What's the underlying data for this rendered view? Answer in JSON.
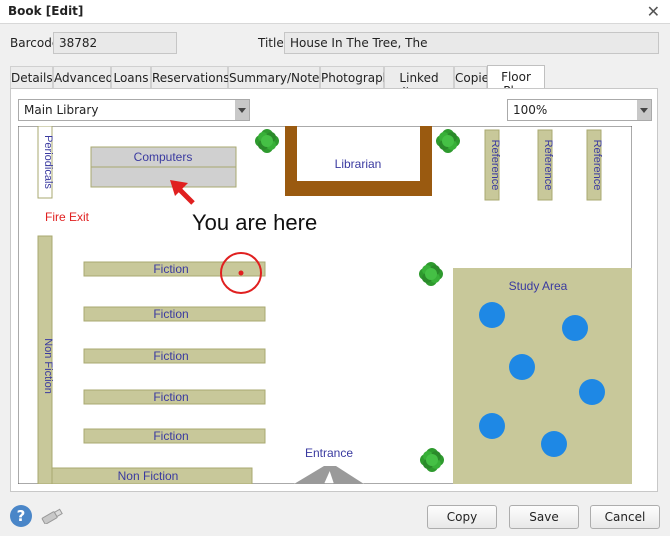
{
  "window": {
    "title": "Book [Edit]"
  },
  "form": {
    "barcode_label": "Barcode",
    "barcode_value": "38782",
    "title_label": "Title",
    "title_value": "House In The Tree, The"
  },
  "tabs": [
    {
      "label": "Details"
    },
    {
      "label": "Advanced"
    },
    {
      "label": "Loans"
    },
    {
      "label": "Reservations"
    },
    {
      "label": "Summary/Notes"
    },
    {
      "label": "Photograph"
    },
    {
      "label": "Linked Items"
    },
    {
      "label": "Copies"
    },
    {
      "label": "Floor Plan",
      "active": true
    }
  ],
  "floor_plan": {
    "location_select": "Main Library",
    "zoom_select": "100%",
    "labels": {
      "periodicals": "Periodicals",
      "computers": "Computers",
      "librarian": "Librarian",
      "reference": "Reference",
      "fire_exit": "Fire Exit",
      "you_are_here": "You are here",
      "fiction": "Fiction",
      "non_fiction": "Non Fiction",
      "study_area": "Study Area",
      "entrance": "Entrance"
    },
    "colors": {
      "shelf": "#c8c89a",
      "desk": "#9a5a10",
      "tables": "#1e88e5",
      "marker": "#e02020",
      "labels": "#3a3aa0"
    }
  },
  "footer": {
    "help_icon": "?",
    "copy_label": "Copy",
    "save_label": "Save",
    "cancel_label": "Cancel"
  }
}
